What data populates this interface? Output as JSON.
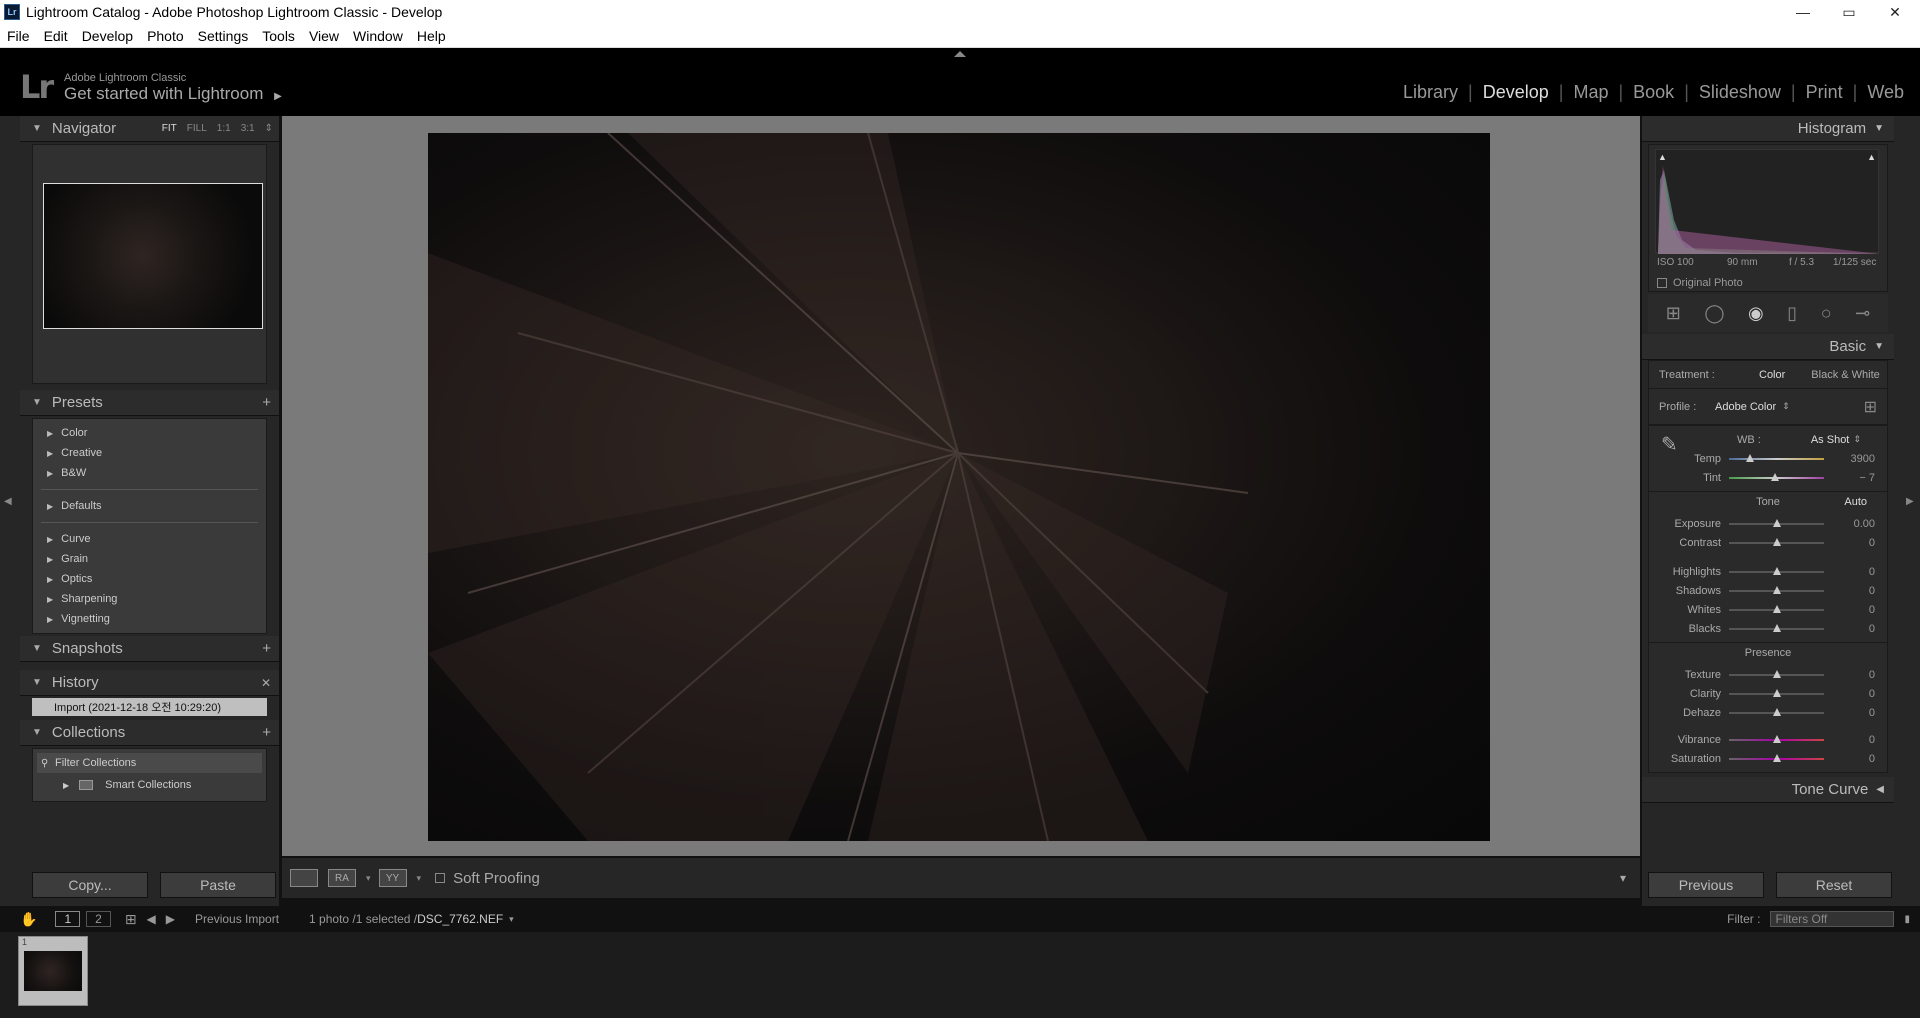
{
  "window": {
    "title": "Lightroom Catalog - Adobe Photoshop Lightroom Classic - Develop",
    "app_icon_label": "Lr",
    "minimize": "—",
    "maximize": "▭",
    "close": "✕"
  },
  "menu": [
    "File",
    "Edit",
    "Develop",
    "Photo",
    "Settings",
    "Tools",
    "View",
    "Window",
    "Help"
  ],
  "header": {
    "logo": "Lr",
    "product": "Adobe Lightroom Classic",
    "tagline": "Get started with Lightroom",
    "tagline_arrow": "▶",
    "modules": [
      "Library",
      "Develop",
      "Map",
      "Book",
      "Slideshow",
      "Print",
      "Web"
    ],
    "active_module": "Develop",
    "separator": "|"
  },
  "left": {
    "navigator": {
      "title": "Navigator",
      "zoom_options": [
        "FIT",
        "FILL",
        "1:1",
        "3:1"
      ],
      "active_zoom": "FIT",
      "zoom_more": "⇕"
    },
    "presets": {
      "title": "Presets",
      "add": "+",
      "groups_a": [
        "Color",
        "Creative",
        "B&W"
      ],
      "groups_b": [
        "Defaults"
      ],
      "groups_c": [
        "Curve",
        "Grain",
        "Optics",
        "Sharpening",
        "Vignetting"
      ]
    },
    "snapshots": {
      "title": "Snapshots",
      "add": "+"
    },
    "history": {
      "title": "History",
      "clear": "✕",
      "items": [
        "Import (2021-12-18 오전 10:29:20)"
      ]
    },
    "collections": {
      "title": "Collections",
      "add": "+",
      "filter_placeholder": "Filter Collections",
      "smart": "Smart Collections"
    },
    "copy": "Copy...",
    "paste": "Paste"
  },
  "toolbar": {
    "soft_proofing": "Soft Proofing",
    "view_ra": "RA",
    "view_yy": "YY",
    "dropdown": "▾"
  },
  "right": {
    "histogram": {
      "title": "Histogram",
      "iso": "ISO 100",
      "focal": "90 mm",
      "aperture": "f / 5.3",
      "shutter": "1/125 sec",
      "original_photo": "Original Photo"
    },
    "basic": {
      "title": "Basic",
      "treatment_label": "Treatment :",
      "treatment_color": "Color",
      "treatment_bw": "Black & White",
      "profile_label": "Profile :",
      "profile_value": "Adobe Color",
      "wb_label": "WB :",
      "wb_value": "As Shot",
      "wb_sliders": [
        {
          "label": "Temp",
          "value": "3900",
          "pos": 0.22
        },
        {
          "label": "Tint",
          "value": "− 7",
          "pos": 0.48
        }
      ],
      "tone_label": "Tone",
      "auto": "Auto",
      "tone_sliders_a": [
        {
          "label": "Exposure",
          "value": "0.00",
          "pos": 0.5
        },
        {
          "label": "Contrast",
          "value": "0",
          "pos": 0.5
        }
      ],
      "tone_sliders_b": [
        {
          "label": "Highlights",
          "value": "0",
          "pos": 0.5
        },
        {
          "label": "Shadows",
          "value": "0",
          "pos": 0.5
        },
        {
          "label": "Whites",
          "value": "0",
          "pos": 0.5
        },
        {
          "label": "Blacks",
          "value": "0",
          "pos": 0.5
        }
      ],
      "presence_label": "Presence",
      "presence_a": [
        {
          "label": "Texture",
          "value": "0",
          "pos": 0.5
        },
        {
          "label": "Clarity",
          "value": "0",
          "pos": 0.5
        },
        {
          "label": "Dehaze",
          "value": "0",
          "pos": 0.5
        }
      ],
      "presence_b": [
        {
          "label": "Vibrance",
          "value": "0",
          "pos": 0.5
        },
        {
          "label": "Saturation",
          "value": "0",
          "pos": 0.5
        }
      ]
    },
    "tone_curve": {
      "title": "Tone Curve"
    },
    "previous": "Previous",
    "reset": "Reset"
  },
  "filmstrip": {
    "page1": "1",
    "page2": "2",
    "source": "Previous Import",
    "count": "1 photo /1 selected /",
    "filename": "DSC_7762.NEF",
    "filter_label": "Filter :",
    "filter_value": "Filters Off",
    "thumb_index": "1"
  }
}
